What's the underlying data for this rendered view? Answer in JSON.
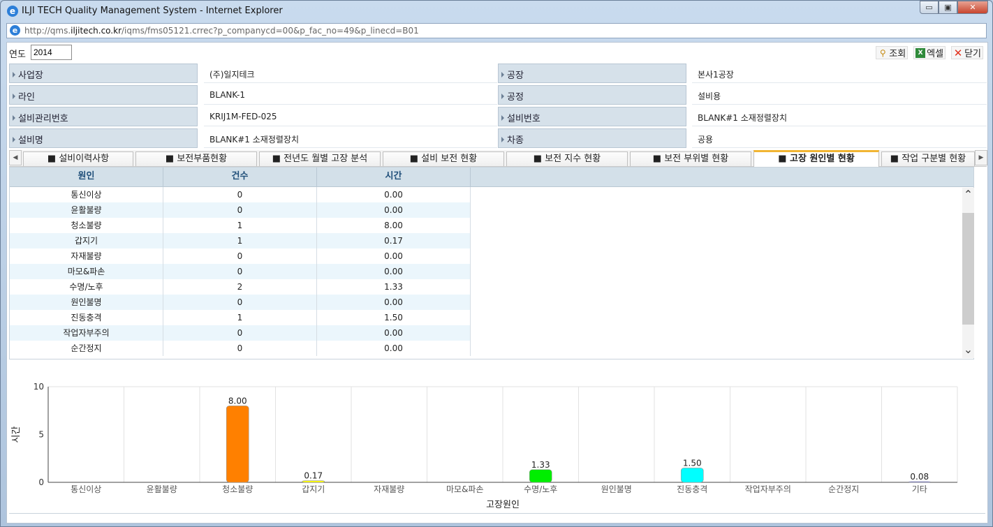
{
  "window": {
    "title": "ILJI TECH Quality Management System - Internet Explorer",
    "url_prefix": "http://qms.",
    "url_domain": "iljitech.co.kr",
    "url_path": "/iqms/fms05121.crrec?p_companycd=00&p_fac_no=49&p_linecd=B01",
    "minimize": "▭",
    "maximize": "▣",
    "close": "✕",
    "ie_icon": "e"
  },
  "toolbar": {
    "year_label": "연도",
    "year_value": "2014",
    "search_label": "조회",
    "excel_label": "엑셀",
    "close_label": "닫기"
  },
  "info": {
    "business_label": "사업장",
    "business_value": "(주)일지테크",
    "factory_label": "공장",
    "factory_value": "본사1공장",
    "line_label": "라인",
    "line_value": "BLANK-1",
    "process_label": "공정",
    "process_value": "설비용",
    "mgmt_no_label": "설비관리번호",
    "mgmt_no_value": "KRIJ1M-FED-025",
    "equip_no_label": "설비번호",
    "equip_no_value": "BLANK#1 소재정렬장치",
    "equip_name_label": "설비명",
    "equip_name_value": "BLANK#1 소재정렬장치",
    "car_label": "차종",
    "car_value": "공용"
  },
  "tabs": [
    "■ 설비이력사항",
    "■ 보전부품현황",
    "■ 전년도 월별 고장 분석",
    "■ 설비 보전 현황",
    "■ 보전 지수 현황",
    "■ 보전 부위별 현황",
    "■ 고장 원인별 현황",
    "■ 작업 구분별 현황"
  ],
  "tab_arrows": {
    "left": "◀",
    "right": "▶"
  },
  "grid": {
    "headers": {
      "cause": "원인",
      "count": "건수",
      "time": "시간"
    },
    "rows": [
      {
        "cause": "통신이상",
        "count": "0",
        "time": "0.00"
      },
      {
        "cause": "윤활불량",
        "count": "0",
        "time": "0.00"
      },
      {
        "cause": "청소불량",
        "count": "1",
        "time": "8.00"
      },
      {
        "cause": "갑지기",
        "count": "1",
        "time": "0.17"
      },
      {
        "cause": "자재불량",
        "count": "0",
        "time": "0.00"
      },
      {
        "cause": "마모&파손",
        "count": "0",
        "time": "0.00"
      },
      {
        "cause": "수명/노후",
        "count": "2",
        "time": "1.33"
      },
      {
        "cause": "원인불명",
        "count": "0",
        "time": "0.00"
      },
      {
        "cause": "진동충격",
        "count": "1",
        "time": "1.50"
      },
      {
        "cause": "작업자부주의",
        "count": "0",
        "time": "0.00"
      },
      {
        "cause": "순간정지",
        "count": "0",
        "time": "0.00"
      }
    ],
    "scroll_up": "⌃",
    "scroll_down": "⌄"
  },
  "chart_data": {
    "type": "bar",
    "categories": [
      "통신이상",
      "윤활불량",
      "청소불량",
      "갑지기",
      "자재불량",
      "마모&파손",
      "수명/노후",
      "원인불명",
      "진동충격",
      "작업자부주의",
      "순간정지",
      "기타"
    ],
    "values": [
      0,
      0,
      8.0,
      0.17,
      0,
      0,
      1.33,
      0,
      1.5,
      0,
      0,
      0.08
    ],
    "labels": [
      "",
      "",
      "8.00",
      "0.17",
      "",
      "",
      "1.33",
      "",
      "1.50",
      "",
      "",
      "0.08"
    ],
    "colors": [
      "#ff8000",
      "#ff8000",
      "#ff8000",
      "#ffff00",
      "#ff8000",
      "#ff8000",
      "#00ee00",
      "#ff8000",
      "#00ffff",
      "#ff8000",
      "#ff8000",
      "#8080ff"
    ],
    "xlabel": "고장원인",
    "ylabel": "시간",
    "ylim": [
      0,
      10
    ],
    "yticks": [
      "0",
      "5",
      "10"
    ],
    "grid": true
  }
}
